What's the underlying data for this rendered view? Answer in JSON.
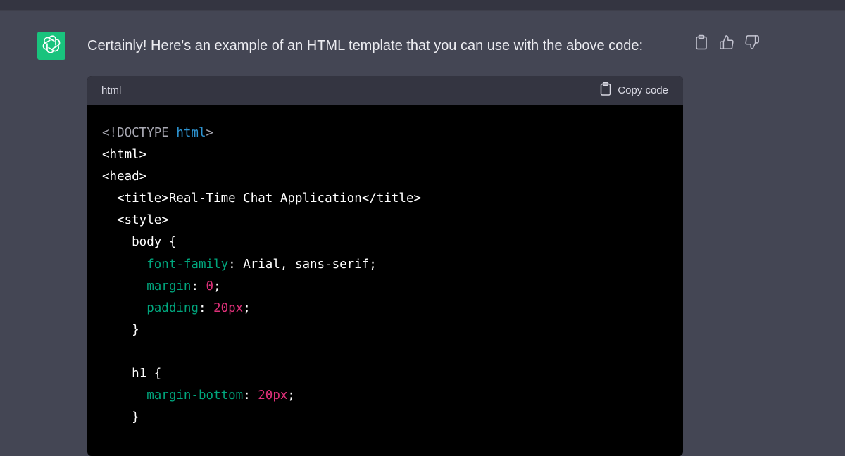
{
  "message": {
    "text": "Certainly! Here's an example of an HTML template that you can use with the above code:"
  },
  "avatar": {
    "icon": "openai-logo-icon",
    "color": "#19c37d"
  },
  "actions": [
    {
      "icon": "clipboard-icon"
    },
    {
      "icon": "thumbs-up-icon"
    },
    {
      "icon": "thumbs-down-icon"
    }
  ],
  "code_block": {
    "language": "html",
    "copy_label": "Copy code",
    "lines": [
      [
        {
          "t": "<!DOCTYPE ",
          "c": "meta"
        },
        {
          "t": "html",
          "c": "kw"
        },
        {
          "t": ">",
          "c": "meta"
        }
      ],
      [
        {
          "t": "<html>",
          "c": "tag"
        }
      ],
      [
        {
          "t": "<head>",
          "c": "tag"
        }
      ],
      [
        {
          "t": "  <title>Real-Time Chat Application</title>",
          "c": "tag"
        }
      ],
      [
        {
          "t": "  <style>",
          "c": "tag"
        }
      ],
      [
        {
          "t": "    body {",
          "c": "sel"
        }
      ],
      [
        {
          "t": "      ",
          "c": "plain"
        },
        {
          "t": "font-family",
          "c": "prop"
        },
        {
          "t": ": Arial, sans-serif;",
          "c": "plain"
        }
      ],
      [
        {
          "t": "      ",
          "c": "plain"
        },
        {
          "t": "margin",
          "c": "prop"
        },
        {
          "t": ": ",
          "c": "plain"
        },
        {
          "t": "0",
          "c": "num"
        },
        {
          "t": ";",
          "c": "plain"
        }
      ],
      [
        {
          "t": "      ",
          "c": "plain"
        },
        {
          "t": "padding",
          "c": "prop"
        },
        {
          "t": ": ",
          "c": "plain"
        },
        {
          "t": "20px",
          "c": "num"
        },
        {
          "t": ";",
          "c": "plain"
        }
      ],
      [
        {
          "t": "    }",
          "c": "sel"
        }
      ],
      [
        {
          "t": "",
          "c": "plain"
        }
      ],
      [
        {
          "t": "    h1 {",
          "c": "sel"
        }
      ],
      [
        {
          "t": "      ",
          "c": "plain"
        },
        {
          "t": "margin-bottom",
          "c": "prop"
        },
        {
          "t": ": ",
          "c": "plain"
        },
        {
          "t": "20px",
          "c": "num"
        },
        {
          "t": ";",
          "c": "plain"
        }
      ],
      [
        {
          "t": "    }",
          "c": "sel"
        }
      ]
    ]
  },
  "colors": {
    "background": "#444654",
    "code_background": "#000000",
    "code_header": "#343541",
    "keyword": "#2e95d3",
    "property": "#00a67d",
    "number": "#df3079"
  }
}
